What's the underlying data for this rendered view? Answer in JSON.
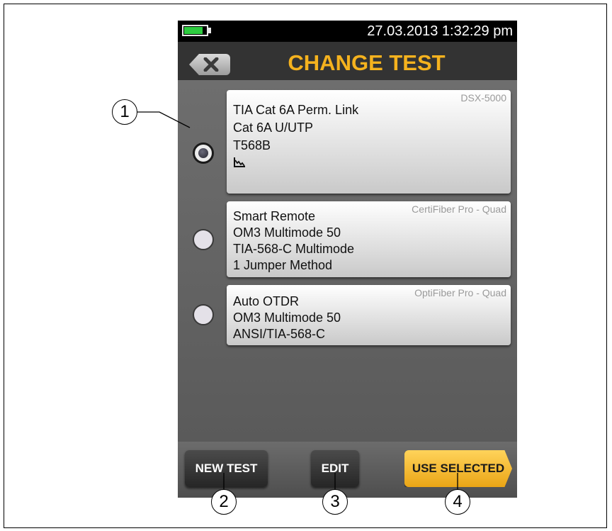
{
  "status_bar": {
    "battery_level": 0.85,
    "datetime": "27.03.2013 1:32:29 pm"
  },
  "header": {
    "back_icon": "close-x-icon",
    "title": "CHANGE TEST"
  },
  "tests": [
    {
      "selected": true,
      "device": "DSX-5000",
      "lines": [
        "TIA Cat 6A Perm. Link",
        "Cat 6A U/UTP",
        "T568B"
      ],
      "icon": "graph-plot-icon"
    },
    {
      "selected": false,
      "device": "CertiFiber Pro - Quad",
      "lines": [
        "Smart Remote",
        "OM3 Multimode 50",
        "TIA-568-C Multimode",
        "1 Jumper Method"
      ]
    },
    {
      "selected": false,
      "device": "OptiFiber Pro - Quad",
      "lines": [
        "Auto OTDR",
        "OM3 Multimode 50",
        "ANSI/TIA-568-C"
      ]
    }
  ],
  "footer": {
    "new_test": "NEW TEST",
    "edit": "EDIT",
    "use_selected": "USE SELECTED"
  },
  "callouts": [
    "1",
    "2",
    "3",
    "4"
  ],
  "colors": {
    "title": "#f5b21e",
    "primary_button": "#f2b731",
    "battery": "#2ecc40"
  }
}
